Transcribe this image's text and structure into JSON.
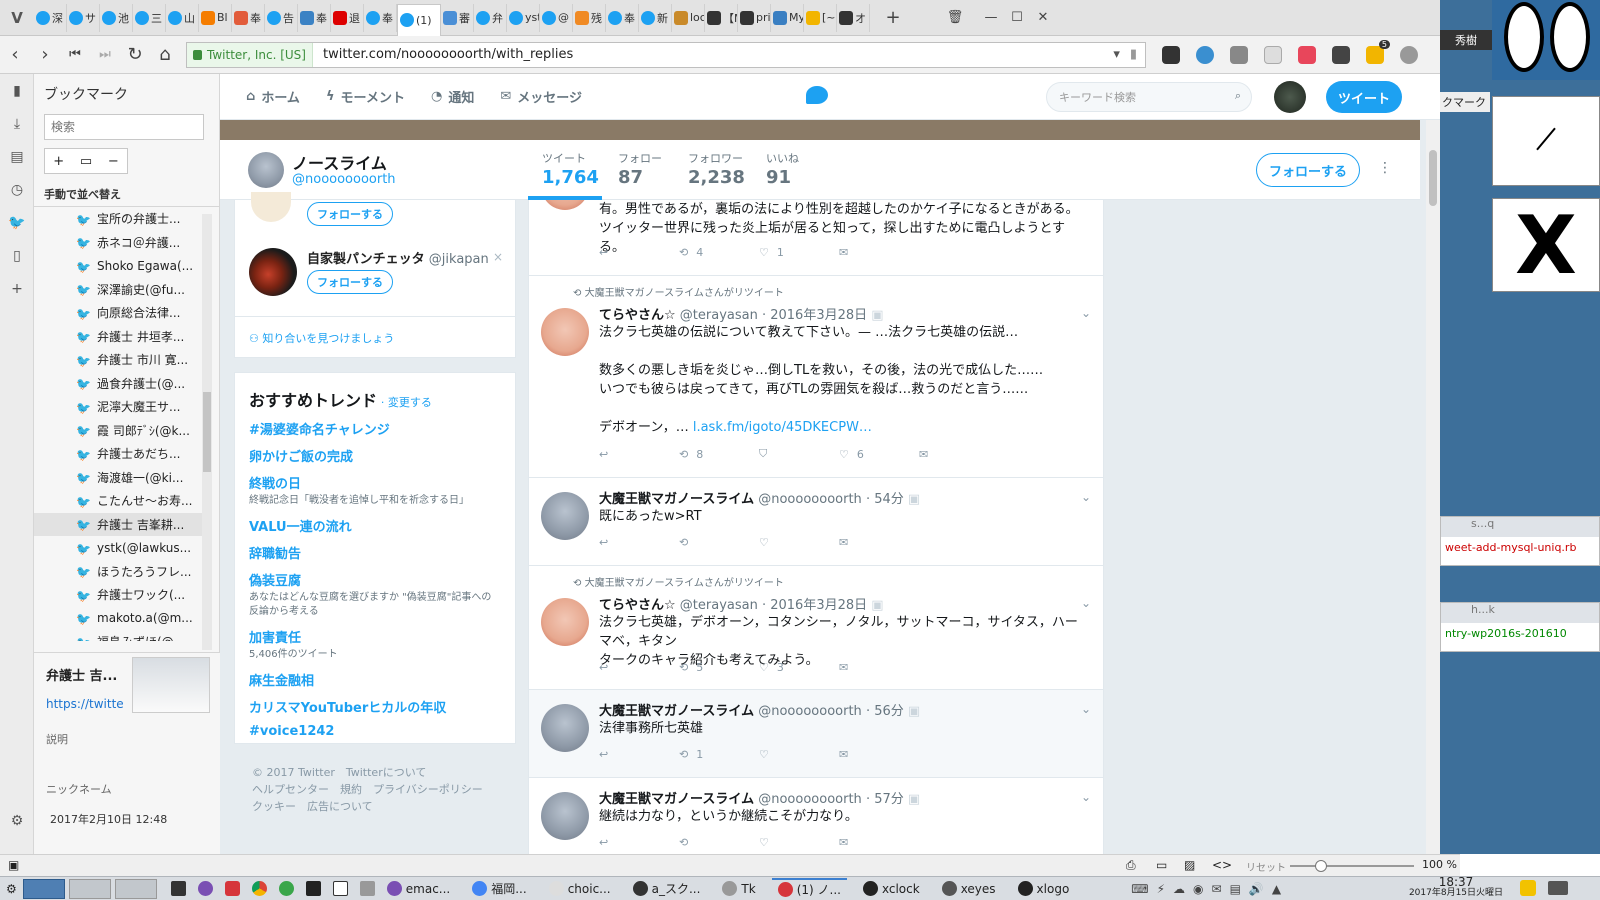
{
  "tabs": [
    {
      "label": "深",
      "icon": "twitter"
    },
    {
      "label": "サ",
      "icon": "twitter"
    },
    {
      "label": "池",
      "icon": "twitter"
    },
    {
      "label": "三",
      "icon": "twitter"
    },
    {
      "label": "山",
      "icon": "twitter"
    },
    {
      "label": "Bl",
      "icon": "blogger"
    },
    {
      "label": "奉",
      "icon": "hatena"
    },
    {
      "label": "告",
      "icon": "twitter"
    },
    {
      "label": "奉",
      "icon": "t"
    },
    {
      "label": "退",
      "icon": "yahoo"
    },
    {
      "label": "奉",
      "icon": "twitter"
    },
    {
      "label": "(1)",
      "icon": "twitter",
      "active": true,
      "badge": "1"
    },
    {
      "label": "審",
      "icon": "doc"
    },
    {
      "label": "弁",
      "icon": "twitter"
    },
    {
      "label": "yst",
      "icon": "twitter"
    },
    {
      "label": "@",
      "icon": "twitter"
    },
    {
      "label": "残",
      "icon": "orange"
    },
    {
      "label": "奉",
      "icon": "twitter"
    },
    {
      "label": "新",
      "icon": "twitter"
    },
    {
      "label": "loc",
      "icon": "pma"
    },
    {
      "label": "【M",
      "icon": "dark"
    },
    {
      "label": "pri",
      "icon": "dark"
    },
    {
      "label": "My",
      "icon": "search"
    },
    {
      "label": "[~",
      "icon": "r"
    },
    {
      "label": "オ",
      "icon": "dark"
    }
  ],
  "address": {
    "cert": "Twitter, Inc. [US]",
    "url": "twitter.com/noooooooorth/with_replies",
    "ext_badge": "5"
  },
  "bookmarks": {
    "title": "ブックマーク",
    "search_placeholder": "検索",
    "sort_label": "手動で並べ替え",
    "items": [
      "宝所の弁護士...",
      "赤ネコ＠弁護...",
      "Shoko Egawa(...",
      "深澤諭史(@fu...",
      "向原総合法律...",
      "弁護士 井垣孝...",
      "弁護士 市川 寛...",
      "過食弁護士(@...",
      "泥濘大魔王サ...",
      "霞 司郎ﾃﾞｼ(@k...",
      "弁護士あだち...",
      "海渡雄一(@ki...",
      "こたんせ〜お寿...",
      "弁護士 吉峯耕...",
      "ystk(@lawkus...",
      "ほうたろうフレ...",
      "弁護士ワック(...",
      "makoto.a(@m...",
      "福島みずほ(@..."
    ],
    "selected_index": 13,
    "detail": {
      "name": "弁護士 吉...",
      "url": "https://twitte",
      "desc_label": "説明",
      "nick_label": "ニックネーム",
      "date": "2017年2月10日 12:48"
    }
  },
  "twitter": {
    "nav": [
      "ホーム",
      "モーメント",
      "通知",
      "メッセージ"
    ],
    "search_placeholder": "キーワード検索",
    "tweet_button": "ツイート",
    "profile": {
      "name": "ノースライム",
      "handle": "@noooooooorth"
    },
    "stats": [
      {
        "label": "ツイート",
        "value": "1,764",
        "active": true
      },
      {
        "label": "フォロー",
        "value": "87"
      },
      {
        "label": "フォロワー",
        "value": "2,238"
      },
      {
        "label": "いいね",
        "value": "91"
      }
    ],
    "follow_button": "フォローする",
    "suggest": {
      "follow_label": "フォローする",
      "user_name": "自家製パンチェッタ",
      "user_handle": "@jikapan",
      "find_friends": "知り合いを見つけましょう"
    },
    "trends": {
      "title": "おすすめトレンド",
      "change": "· 変更する",
      "items": [
        {
          "t": "#湯婆婆命名チャレンジ",
          "d": ""
        },
        {
          "t": "卵かけご飯の完成",
          "d": ""
        },
        {
          "t": "終戦の日",
          "d": "終戦記念日「戦没者を追悼し平和を祈念する日」"
        },
        {
          "t": "VALU一連の流れ",
          "d": ""
        },
        {
          "t": "辞職勧告",
          "d": ""
        },
        {
          "t": "偽装豆腐",
          "d": "あなたはどんな豆腐を選びますか \"偽装豆腐\"記事への反論から考える"
        },
        {
          "t": "加害責任",
          "d": "5,406件のツイート"
        },
        {
          "t": "麻生金融相",
          "d": ""
        },
        {
          "t": "カリスマYouTuberヒカルの年収",
          "d": ""
        },
        {
          "t": "#voice1242",
          "d": ""
        }
      ]
    },
    "footer": [
      "© 2017 Twitter　Twitterについて",
      "ヘルプセンター　規約　プライバシーポリシー",
      "クッキー　広告について"
    ],
    "tweets": [
      {
        "partial": true,
        "body": "有。男性であるが，裏垢の法により性別を超越したのかケイ子になるときがある。ツイッター世界に残った炎上垢が居ると知って，探し出すために電凸しようとする。",
        "rt": "4",
        "like": "1"
      },
      {
        "retweeted_by": "大魔王獣マガノースライムさんがリツイート",
        "name": "てらやさん☆",
        "handle": "@terayasan",
        "time": "· 2016年3月28日",
        "avatar": "pig",
        "lines": [
          "法クラ七英雄の伝説について教えて下さい。— …法クラ七英雄の伝説…",
          "",
          "数多くの悪しき垢を炎じゃ…倒しTLを救い，その後，法の光で成仏した……",
          "いつでも彼らは戻ってきて，再びTLの雰囲気を殺ば…救うのだと言う……",
          "",
          "デボオーン，… "
        ],
        "link": "l.ask.fm/igoto/45DKECPW…",
        "rt": "8",
        "like": "6"
      },
      {
        "name": "大魔王獣マガノースライム",
        "handle": "@noooooooorth",
        "time": "· 54分",
        "avatar": "slime",
        "lines": [
          "既にあったw>RT"
        ],
        "rt": "",
        "like": ""
      },
      {
        "retweeted_by": "大魔王獣マガノースライムさんがリツイート",
        "name": "てらやさん☆",
        "handle": "@terayasan",
        "time": "· 2016年3月28日",
        "avatar": "pig",
        "lines": [
          "法クラ七英雄，デボオーン，コタンシー，ノタル，サットマーコ，サイタス，ハーマベ，キタン",
          "タークのキャラ紹介も考えてみよう。"
        ],
        "rt": "5",
        "like": "3"
      },
      {
        "name": "大魔王獣マガノースライム",
        "handle": "@noooooooorth",
        "time": "· 56分",
        "avatar": "slime",
        "lines": [
          "法律事務所七英雄"
        ],
        "rt": "1",
        "like": ""
      },
      {
        "name": "大魔王獣マガノースライム",
        "handle": "@noooooooorth",
        "time": "· 57分",
        "avatar": "slime",
        "lines": [
          "継続は力なり，というか継続こそが力なり。"
        ],
        "rt": "",
        "like": ""
      }
    ]
  },
  "right_panel": {
    "user": "秀樹",
    "file1": "weet-add-mysql-uniq.rb",
    "file1_title": "s...q",
    "file2": "ntry-wp2016s-201610",
    "file2_title": "h...k",
    "bm_label": "クマーク"
  },
  "status": {
    "reset": "リセット",
    "zoom": "100 %",
    "zoom_level": 100
  },
  "taskbar": {
    "items": [
      "emac...",
      "福岡...",
      "choic...",
      "a_スク...",
      "Tk",
      "(1) ノ...",
      "xclock",
      "xeyes",
      "xlogo"
    ],
    "time": "18:37",
    "date": "2017年8月15日火曜日"
  },
  "colors": {
    "twitter_blue": "#1da1f2",
    "timeline_bg": "#e6ecf0"
  }
}
